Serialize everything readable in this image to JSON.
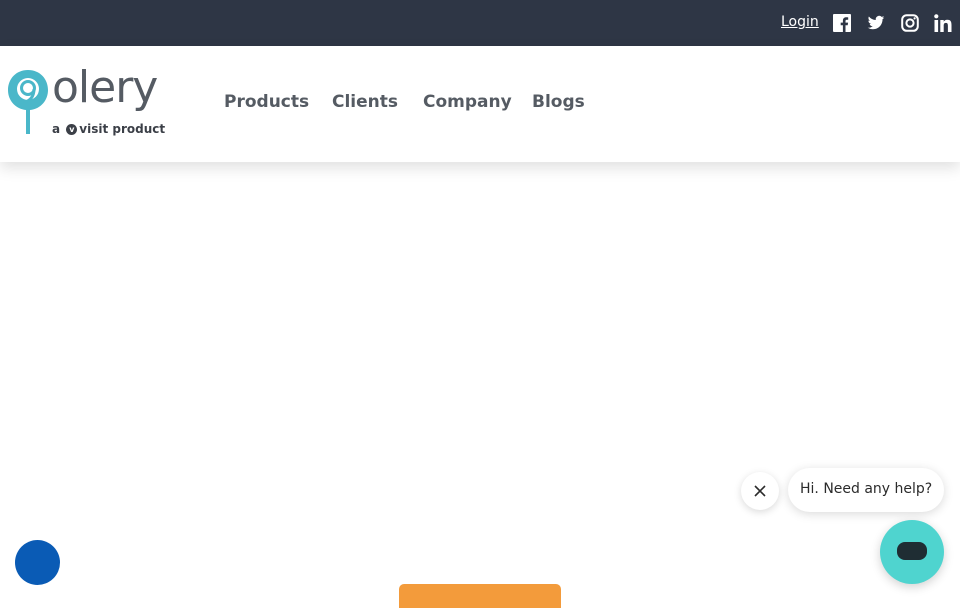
{
  "topbar": {
    "login_label": "Login",
    "social_icons": [
      "facebook-icon",
      "twitter-icon",
      "instagram-icon",
      "linkedin-icon"
    ]
  },
  "brand": {
    "name": "olery",
    "tagline_prefix": "a",
    "tagline_suffix": "visit product",
    "colors": {
      "pin": "#4ab7c9",
      "text": "#555b63"
    }
  },
  "nav": {
    "items": [
      {
        "label": "Products"
      },
      {
        "label": "Clients"
      },
      {
        "label": "Company"
      },
      {
        "label": "Blogs"
      }
    ]
  },
  "chat": {
    "greeting": "Hi. Need any help?"
  },
  "colors": {
    "topbar": "#2e3645",
    "chat_launcher": "#4fd4cf",
    "accessibility": "#0a5bb5",
    "cta": "#f39b3b"
  }
}
